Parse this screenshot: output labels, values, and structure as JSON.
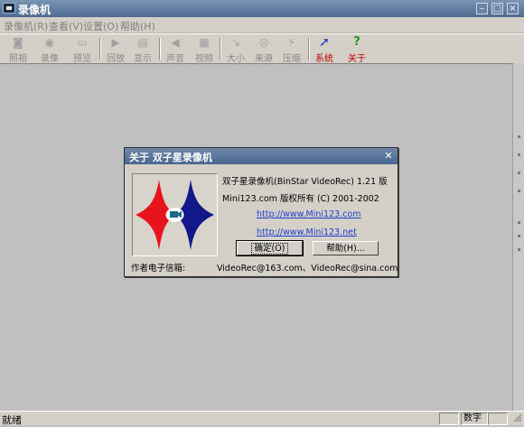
{
  "window": {
    "title": "录像机"
  },
  "menu": [
    "录像机(R)",
    "查看(V)",
    "设置(O)",
    "帮助(H)"
  ],
  "toolbar": {
    "buttons": [
      {
        "label": "照相",
        "icon": "camera-icon"
      },
      {
        "label": "录像",
        "icon": "record-icon"
      },
      {
        "label": "预览",
        "icon": "preview-icon"
      },
      {
        "label": "回放",
        "icon": "play-icon"
      },
      {
        "label": "显示",
        "icon": "display-icon"
      },
      {
        "label": "声音",
        "icon": "speaker-icon"
      },
      {
        "label": "视频",
        "icon": "video-icon"
      },
      {
        "label": "大小",
        "icon": "resize-icon"
      },
      {
        "label": "来源",
        "icon": "source-icon"
      },
      {
        "label": "压缩",
        "icon": "compress-icon"
      },
      {
        "label": "系统",
        "icon": "cursor-icon"
      },
      {
        "label": "关于",
        "icon": "help-icon"
      }
    ]
  },
  "dialog": {
    "title": "关于 双子星录像机",
    "product": "双子星录像机(BinStar VideoRec) 1.21 版",
    "copyright": "Mini123.com 版权所有 (C) 2001-2002",
    "link1": "http://www.Mini123.com",
    "link2": "http://www.Mini123.net",
    "ok_label": "确定(O)",
    "help_label": "帮助(H)...",
    "email_label": "作者电子信箱:",
    "emails": "VideoRec@163.com、VideoRec@sina.com"
  },
  "status": {
    "ready": "就绪",
    "num": "数字"
  },
  "colors": {
    "title_bar": "#5b779e",
    "logo_red": "#e8141b",
    "logo_blue": "#12188a",
    "link": "#1e3fd0"
  }
}
